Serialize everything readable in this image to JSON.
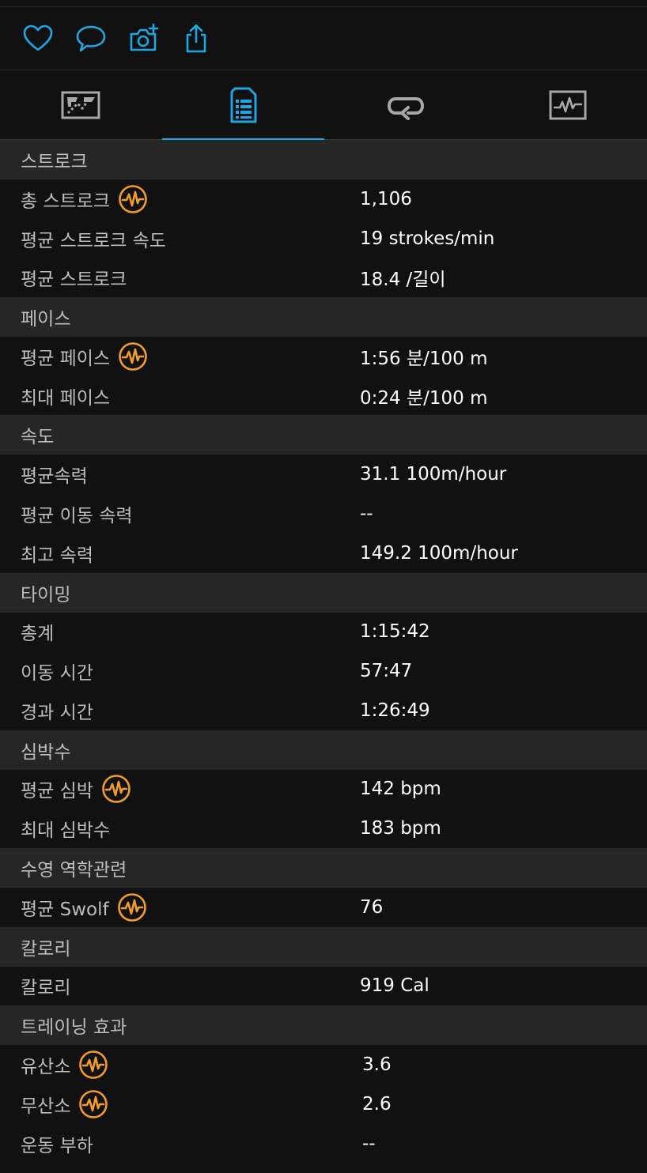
{
  "colors": {
    "accent_blue": "#1ea7e4",
    "badge_orange": "#f39c28",
    "section_bg": "#262626",
    "row_bg": "#111111",
    "label_gray": "#bdbdbd"
  },
  "actions": [
    {
      "icon": "heart-icon"
    },
    {
      "icon": "comment-icon"
    },
    {
      "icon": "add-photo-icon"
    },
    {
      "icon": "share-icon"
    }
  ],
  "tabs": [
    {
      "icon": "map-icon",
      "active": false
    },
    {
      "icon": "stats-list-icon",
      "active": true
    },
    {
      "icon": "laps-icon",
      "active": false
    },
    {
      "icon": "chart-icon",
      "active": false
    }
  ],
  "sections": [
    {
      "title": "스트로크",
      "rows": [
        {
          "label": "총 스트로크",
          "value": "1,106",
          "badge": true
        },
        {
          "label": "평균 스트로크 속도",
          "value": "19 strokes/min",
          "badge": false
        },
        {
          "label": "평균 스트로크",
          "value": "18.4 /길이",
          "badge": false
        }
      ]
    },
    {
      "title": "페이스",
      "rows": [
        {
          "label": "평균 페이스",
          "value": "1:56 분/100 m",
          "badge": true
        },
        {
          "label": "최대 페이스",
          "value": "0:24 분/100 m",
          "badge": false
        }
      ]
    },
    {
      "title": "속도",
      "rows": [
        {
          "label": "평균속력",
          "value": "31.1 100m/hour",
          "badge": false
        },
        {
          "label": "평균 이동 속력",
          "value": "--",
          "badge": false
        },
        {
          "label": "최고 속력",
          "value": "149.2 100m/hour",
          "badge": false
        }
      ]
    },
    {
      "title": "타이밍",
      "rows": [
        {
          "label": "총계",
          "value": "1:15:42",
          "badge": false
        },
        {
          "label": "이동 시간",
          "value": "57:47",
          "badge": false
        },
        {
          "label": "경과 시간",
          "value": "1:26:49",
          "badge": false
        }
      ]
    },
    {
      "title": "심박수",
      "rows": [
        {
          "label": "평균 심박",
          "value": "142 bpm",
          "badge": true
        },
        {
          "label": "최대 심박수",
          "value": "183 bpm",
          "badge": false
        }
      ]
    },
    {
      "title": "수영 역학관련",
      "rows": [
        {
          "label": "평균 Swolf",
          "value": "76",
          "badge": true
        }
      ]
    },
    {
      "title": "칼로리",
      "rows": [
        {
          "label": "칼로리",
          "value": "919 Cal",
          "badge": false
        }
      ]
    },
    {
      "title": "트레이닝 효과",
      "rows": [
        {
          "label": "유산소",
          "value": "3.6",
          "badge": true
        },
        {
          "label": "무산소",
          "value": "2.6",
          "badge": true
        },
        {
          "label": "운동 부하",
          "value": "--",
          "badge": false
        }
      ]
    }
  ]
}
